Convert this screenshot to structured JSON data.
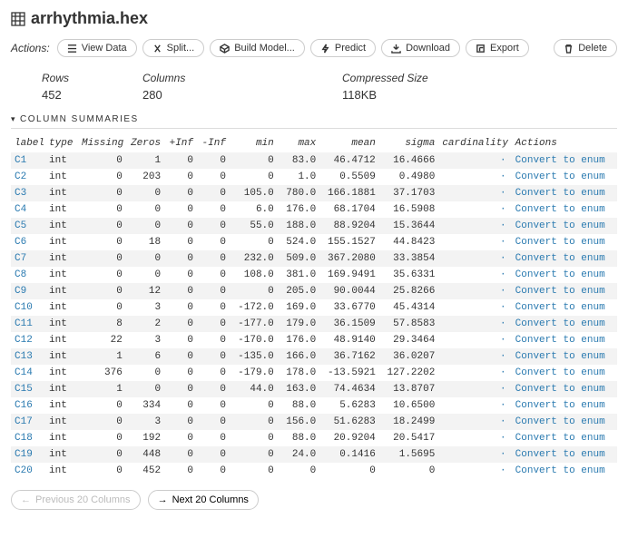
{
  "title": "arrhythmia.hex",
  "actions_label": "Actions:",
  "buttons": {
    "view_data": "View Data",
    "split": "Split...",
    "build_model": "Build Model...",
    "predict": "Predict",
    "download": "Download",
    "export": "Export",
    "delete": "Delete"
  },
  "stats": {
    "rows_label": "Rows",
    "rows_value": "452",
    "cols_label": "Columns",
    "cols_value": "280",
    "size_label": "Compressed Size",
    "size_value": "118KB"
  },
  "section_title": "COLUMN SUMMARIES",
  "headers": {
    "label": "label",
    "type": "type",
    "missing": "Missing",
    "zeros": "Zeros",
    "pinf": "+Inf",
    "ninf": "-Inf",
    "min": "min",
    "max": "max",
    "mean": "mean",
    "sigma": "sigma",
    "cardinality": "cardinality",
    "actions": "Actions"
  },
  "convert_label": "Convert to enum",
  "chart_data": {
    "type": "table",
    "columns": [
      "label",
      "type",
      "Missing",
      "Zeros",
      "+Inf",
      "-Inf",
      "min",
      "max",
      "mean",
      "sigma",
      "cardinality"
    ],
    "rows": [
      {
        "label": "C1",
        "type": "int",
        "missing": "0",
        "zeros": "1",
        "pinf": "0",
        "ninf": "0",
        "min": "0",
        "max": "83.0",
        "mean": "46.4712",
        "sigma": "16.4666",
        "cardinality": "·"
      },
      {
        "label": "C2",
        "type": "int",
        "missing": "0",
        "zeros": "203",
        "pinf": "0",
        "ninf": "0",
        "min": "0",
        "max": "1.0",
        "mean": "0.5509",
        "sigma": "0.4980",
        "cardinality": "·"
      },
      {
        "label": "C3",
        "type": "int",
        "missing": "0",
        "zeros": "0",
        "pinf": "0",
        "ninf": "0",
        "min": "105.0",
        "max": "780.0",
        "mean": "166.1881",
        "sigma": "37.1703",
        "cardinality": "·"
      },
      {
        "label": "C4",
        "type": "int",
        "missing": "0",
        "zeros": "0",
        "pinf": "0",
        "ninf": "0",
        "min": "6.0",
        "max": "176.0",
        "mean": "68.1704",
        "sigma": "16.5908",
        "cardinality": "·"
      },
      {
        "label": "C5",
        "type": "int",
        "missing": "0",
        "zeros": "0",
        "pinf": "0",
        "ninf": "0",
        "min": "55.0",
        "max": "188.0",
        "mean": "88.9204",
        "sigma": "15.3644",
        "cardinality": "·"
      },
      {
        "label": "C6",
        "type": "int",
        "missing": "0",
        "zeros": "18",
        "pinf": "0",
        "ninf": "0",
        "min": "0",
        "max": "524.0",
        "mean": "155.1527",
        "sigma": "44.8423",
        "cardinality": "·"
      },
      {
        "label": "C7",
        "type": "int",
        "missing": "0",
        "zeros": "0",
        "pinf": "0",
        "ninf": "0",
        "min": "232.0",
        "max": "509.0",
        "mean": "367.2080",
        "sigma": "33.3854",
        "cardinality": "·"
      },
      {
        "label": "C8",
        "type": "int",
        "missing": "0",
        "zeros": "0",
        "pinf": "0",
        "ninf": "0",
        "min": "108.0",
        "max": "381.0",
        "mean": "169.9491",
        "sigma": "35.6331",
        "cardinality": "·"
      },
      {
        "label": "C9",
        "type": "int",
        "missing": "0",
        "zeros": "12",
        "pinf": "0",
        "ninf": "0",
        "min": "0",
        "max": "205.0",
        "mean": "90.0044",
        "sigma": "25.8266",
        "cardinality": "·"
      },
      {
        "label": "C10",
        "type": "int",
        "missing": "0",
        "zeros": "3",
        "pinf": "0",
        "ninf": "0",
        "min": "-172.0",
        "max": "169.0",
        "mean": "33.6770",
        "sigma": "45.4314",
        "cardinality": "·"
      },
      {
        "label": "C11",
        "type": "int",
        "missing": "8",
        "zeros": "2",
        "pinf": "0",
        "ninf": "0",
        "min": "-177.0",
        "max": "179.0",
        "mean": "36.1509",
        "sigma": "57.8583",
        "cardinality": "·"
      },
      {
        "label": "C12",
        "type": "int",
        "missing": "22",
        "zeros": "3",
        "pinf": "0",
        "ninf": "0",
        "min": "-170.0",
        "max": "176.0",
        "mean": "48.9140",
        "sigma": "29.3464",
        "cardinality": "·"
      },
      {
        "label": "C13",
        "type": "int",
        "missing": "1",
        "zeros": "6",
        "pinf": "0",
        "ninf": "0",
        "min": "-135.0",
        "max": "166.0",
        "mean": "36.7162",
        "sigma": "36.0207",
        "cardinality": "·"
      },
      {
        "label": "C14",
        "type": "int",
        "missing": "376",
        "zeros": "0",
        "pinf": "0",
        "ninf": "0",
        "min": "-179.0",
        "max": "178.0",
        "mean": "-13.5921",
        "sigma": "127.2202",
        "cardinality": "·"
      },
      {
        "label": "C15",
        "type": "int",
        "missing": "1",
        "zeros": "0",
        "pinf": "0",
        "ninf": "0",
        "min": "44.0",
        "max": "163.0",
        "mean": "74.4634",
        "sigma": "13.8707",
        "cardinality": "·"
      },
      {
        "label": "C16",
        "type": "int",
        "missing": "0",
        "zeros": "334",
        "pinf": "0",
        "ninf": "0",
        "min": "0",
        "max": "88.0",
        "mean": "5.6283",
        "sigma": "10.6500",
        "cardinality": "·"
      },
      {
        "label": "C17",
        "type": "int",
        "missing": "0",
        "zeros": "3",
        "pinf": "0",
        "ninf": "0",
        "min": "0",
        "max": "156.0",
        "mean": "51.6283",
        "sigma": "18.2499",
        "cardinality": "·"
      },
      {
        "label": "C18",
        "type": "int",
        "missing": "0",
        "zeros": "192",
        "pinf": "0",
        "ninf": "0",
        "min": "0",
        "max": "88.0",
        "mean": "20.9204",
        "sigma": "20.5417",
        "cardinality": "·"
      },
      {
        "label": "C19",
        "type": "int",
        "missing": "0",
        "zeros": "448",
        "pinf": "0",
        "ninf": "0",
        "min": "0",
        "max": "24.0",
        "mean": "0.1416",
        "sigma": "1.5695",
        "cardinality": "·"
      },
      {
        "label": "C20",
        "type": "int",
        "missing": "0",
        "zeros": "452",
        "pinf": "0",
        "ninf": "0",
        "min": "0",
        "max": "0",
        "mean": "0",
        "sigma": "0",
        "cardinality": "·"
      }
    ]
  },
  "pager": {
    "prev": "Previous 20 Columns",
    "next": "Next 20 Columns"
  }
}
